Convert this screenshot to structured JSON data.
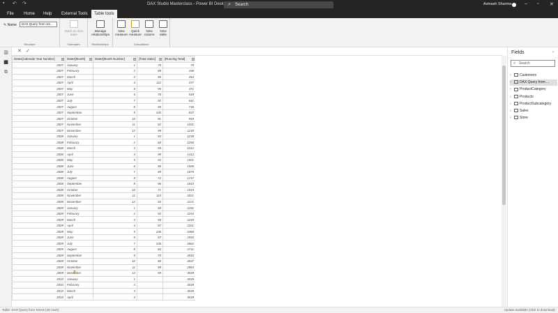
{
  "titlebar": {
    "title": "DAX Studio Masterclass - Power BI Desktop",
    "search": "Search",
    "user": "Avinash Sharma"
  },
  "menu": [
    {
      "label": "File"
    },
    {
      "label": "Home"
    },
    {
      "label": "Help"
    },
    {
      "label": "External Tools"
    },
    {
      "label": "Table tools"
    }
  ],
  "ribbon": {
    "name_label": "Name",
    "name_value": "DAX Query from SS...",
    "groups": {
      "structure": "Structure",
      "calendars": "Calendars",
      "relationships": "Relationships",
      "calculations": "Calculations"
    },
    "buttons": {
      "mark_date": "Mark as date table",
      "manage_rel": "Manage relationships",
      "new_measure": "New measure",
      "quick_measure": "Quick measure",
      "new_column": "New column",
      "new_table": "New table"
    }
  },
  "table": {
    "headers": [
      "Dates[Calendar Year Number]",
      "Dates[Month]",
      "Dates[Month Number]",
      "[Total Sales]",
      "[Running Total]"
    ],
    "rows": [
      [
        "2007",
        "January",
        "1",
        "79",
        "79"
      ],
      [
        "2007",
        "February",
        "2",
        "89",
        "168"
      ],
      [
        "2007",
        "March",
        "3",
        "96",
        "264"
      ],
      [
        "2007",
        "April",
        "4",
        "112",
        "377"
      ],
      [
        "2007",
        "May",
        "5",
        "95",
        "471"
      ],
      [
        "2007",
        "June",
        "6",
        "78",
        "549"
      ],
      [
        "2007",
        "July",
        "7",
        "92",
        "641"
      ],
      [
        "2007",
        "August",
        "8",
        "95",
        "736"
      ],
      [
        "2007",
        "September",
        "9",
        "100",
        "837"
      ],
      [
        "2007",
        "October",
        "10",
        "91",
        "949"
      ],
      [
        "2007",
        "November",
        "11",
        "82",
        "1031"
      ],
      [
        "2007",
        "December",
        "12",
        "99",
        "1130"
      ],
      [
        "2008",
        "January",
        "1",
        "93",
        "1236"
      ],
      [
        "2008",
        "February",
        "2",
        "60",
        "1256"
      ],
      [
        "2008",
        "March",
        "3",
        "55",
        "1312"
      ],
      [
        "2008",
        "April",
        "4",
        "99",
        "1412"
      ],
      [
        "2008",
        "May",
        "5",
        "93",
        "1501"
      ],
      [
        "2008",
        "June",
        "6",
        "96",
        "1596"
      ],
      [
        "2008",
        "July",
        "7",
        "89",
        "1675"
      ],
      [
        "2008",
        "August",
        "8",
        "72",
        "1747"
      ],
      [
        "2008",
        "September",
        "9",
        "96",
        "1843"
      ],
      [
        "2008",
        "October",
        "10",
        "71",
        "1919"
      ],
      [
        "2008",
        "November",
        "11",
        "115",
        "2021"
      ],
      [
        "2008",
        "December",
        "12",
        "92",
        "2121"
      ],
      [
        "2009",
        "January",
        "1",
        "59",
        "2181"
      ],
      [
        "2009",
        "February",
        "2",
        "92",
        "2244"
      ],
      [
        "2009",
        "March",
        "3",
        "59",
        "2240"
      ],
      [
        "2009",
        "April",
        "4",
        "87",
        "2331"
      ],
      [
        "2009",
        "May",
        "5",
        "106",
        "2468"
      ],
      [
        "2009",
        "June",
        "6",
        "87",
        "2555"
      ],
      [
        "2009",
        "July",
        "7",
        "106",
        "2662"
      ],
      [
        "2009",
        "August",
        "8",
        "83",
        "2741"
      ],
      [
        "2009",
        "September",
        "9",
        "70",
        "2816"
      ],
      [
        "2009",
        "October",
        "10",
        "80",
        "2837"
      ],
      [
        "2009",
        "November",
        "11",
        "99",
        "2984"
      ],
      [
        "2009",
        "December",
        "12",
        "59",
        "3039"
      ],
      [
        "2010",
        "January",
        "1",
        "",
        "3039"
      ],
      [
        "2010",
        "February",
        "2",
        "",
        "3039"
      ],
      [
        "2010",
        "March",
        "3",
        "",
        "3039"
      ],
      [
        "2010",
        "April",
        "4",
        "",
        "3039"
      ]
    ]
  },
  "fields": {
    "title": "Fields",
    "search_placeholder": "Search",
    "items": [
      {
        "label": "Customers",
        "selected": false
      },
      {
        "label": "DAX Query from ...",
        "selected": true
      },
      {
        "label": "ProductCategory",
        "selected": false
      },
      {
        "label": "Products",
        "selected": false
      },
      {
        "label": "ProductSubcategory",
        "selected": false
      },
      {
        "label": "Sales",
        "selected": false
      },
      {
        "label": "Store",
        "selected": false
      }
    ]
  },
  "status": {
    "left": "Table: DAX Query from SSAS (40 rows)",
    "right": "Update available (click to download)"
  },
  "icons": [
    "search-icon",
    "report-view-icon",
    "table-view-icon",
    "model-view-icon",
    "cancel-icon",
    "commit-icon",
    "chevron-right-icon",
    "table-icon",
    "minimize-icon",
    "maximize-icon",
    "close-icon"
  ]
}
